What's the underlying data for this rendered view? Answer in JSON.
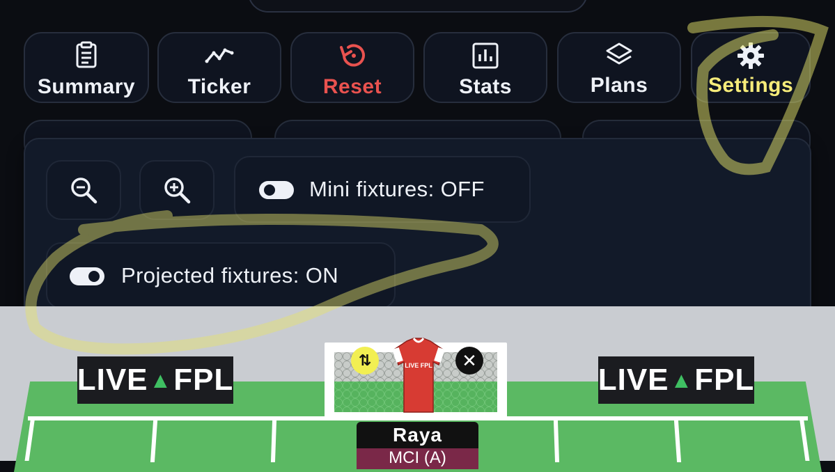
{
  "toolbar": {
    "summary_label": "Summary",
    "ticker_label": "Ticker",
    "reset_label": "Reset",
    "stats_label": "Stats",
    "plans_label": "Plans",
    "settings_label": "Settings"
  },
  "settings_panel": {
    "zoom_out_icon": "zoom-out-icon",
    "zoom_in_icon": "zoom-in-icon",
    "mini_fixtures_label": "Mini fixtures: OFF",
    "mini_fixtures_on": false,
    "projected_fixtures_label": "Projected fixtures: ON",
    "projected_fixtures_on": true
  },
  "pitch": {
    "sponsor_left": "LIVE",
    "sponsor_left_mid": "▲",
    "sponsor_left_end": "FPL",
    "sponsor_right": "LIVE",
    "sponsor_right_mid": "▲",
    "sponsor_right_end": "FPL",
    "goalkeeper": {
      "name": "Raya",
      "fixture": "MCI (A)",
      "kit_text": "LIVE FPL"
    }
  },
  "colors": {
    "accent_reset": "#e9524f",
    "accent_settings": "#f6ec7a",
    "pitch_green": "#5bb963",
    "highlight": "#e6e36a"
  }
}
